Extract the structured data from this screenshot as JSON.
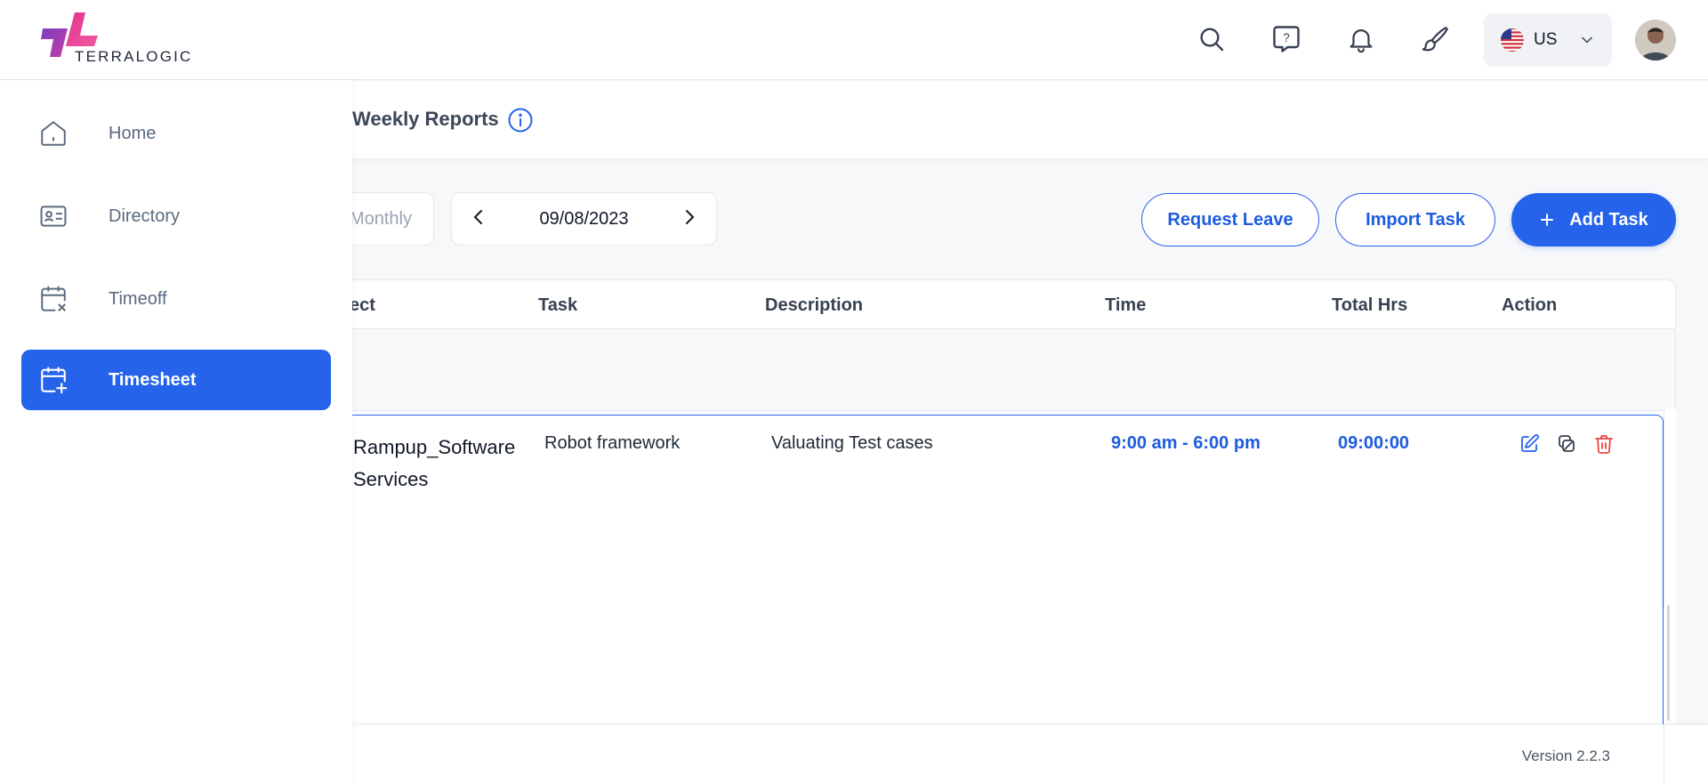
{
  "brand": {
    "logo_text": "TERRALOGIC"
  },
  "header": {
    "language": {
      "label": "US",
      "flag": "us-flag-icon"
    },
    "icons": [
      "search-icon",
      "help-icon",
      "bell-icon",
      "brush-icon"
    ]
  },
  "sidebar": {
    "items": [
      {
        "label": "Home",
        "icon": "home-icon",
        "active": false
      },
      {
        "label": "Directory",
        "icon": "id-card-icon",
        "active": false
      },
      {
        "label": "Timeoff",
        "icon": "calendar-x-icon",
        "active": false
      },
      {
        "label": "Timesheet",
        "icon": "calendar-plus-icon",
        "active": true
      }
    ]
  },
  "page": {
    "title": "Weekly Reports"
  },
  "controls": {
    "period_tab": "Monthly",
    "date": "09/08/2023",
    "request_leave": "Request Leave",
    "import_task": "Import Task",
    "add_task": "Add Task"
  },
  "table": {
    "columns": [
      "ect",
      "Task",
      "Description",
      "Time",
      "Total Hrs",
      "Action"
    ],
    "rows": [
      {
        "project": "Rampup_Software Services",
        "task": "Robot framework",
        "description": "Valuating Test cases",
        "time": "9:00 am - 6:00 pm",
        "total_hrs": "09:00:00"
      }
    ]
  },
  "footer": {
    "version": "Version 2.2.3"
  },
  "colors": {
    "accent": "#2563eb",
    "danger": "#ef4444",
    "text_muted": "#5b6b80"
  }
}
